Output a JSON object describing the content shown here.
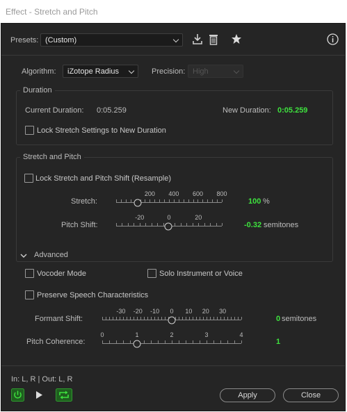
{
  "window": {
    "title": "Effect - Stretch and Pitch"
  },
  "presets": {
    "label": "Presets:",
    "value": "(Custom)"
  },
  "algorithm": {
    "label": "Algorithm:",
    "value": "iZotope Radius"
  },
  "precision": {
    "label": "Precision:",
    "value": "High"
  },
  "duration": {
    "title": "Duration",
    "current_label": "Current Duration:",
    "current_value": "0:05.259",
    "new_label": "New Duration:",
    "new_value": "0:05.259",
    "lock_label": "Lock Stretch Settings to New Duration"
  },
  "stretch_pitch": {
    "title": "Stretch and Pitch",
    "lock_label": "Lock Stretch and Pitch Shift (Resample)",
    "stretch": {
      "label": "Stretch:",
      "ticks": [
        "200",
        "400",
        "600",
        "800"
      ],
      "value": "100",
      "unit": "%",
      "min": 0,
      "max": 800,
      "current": 100
    },
    "pitch": {
      "label": "Pitch Shift:",
      "ticks": [
        "-20",
        "0",
        "20"
      ],
      "value": "-0.32",
      "unit": "semitones",
      "min": -36,
      "max": 36,
      "current": -0.32
    }
  },
  "advanced": {
    "title": "Advanced",
    "vocoder_label": "Vocoder Mode",
    "solo_label": "Solo Instrument or Voice",
    "preserve_label": "Preserve Speech Characteristics",
    "formant": {
      "label": "Formant Shift:",
      "ticks": [
        "-30",
        "-20",
        "-10",
        "0",
        "10",
        "20",
        "30"
      ],
      "value": "0",
      "unit": "semitones",
      "min": -36,
      "max": 36,
      "current": 0
    },
    "coherence": {
      "label": "Pitch Coherence:",
      "ticks": [
        "0",
        "1",
        "2",
        "3",
        "4"
      ],
      "value": "1",
      "min": 0,
      "max": 4,
      "current": 1
    }
  },
  "footer": {
    "io_label": "In: L, R | Out: L, R",
    "apply_label": "Apply",
    "close_label": "Close"
  },
  "colors": {
    "accent_green": "#3ee23e",
    "background": "#252525"
  },
  "icons": [
    "download-preset-icon",
    "delete-preset-icon",
    "favorite-star-icon",
    "info-icon",
    "power-icon",
    "play-icon",
    "loop-icon",
    "chevron-down-icon"
  ]
}
